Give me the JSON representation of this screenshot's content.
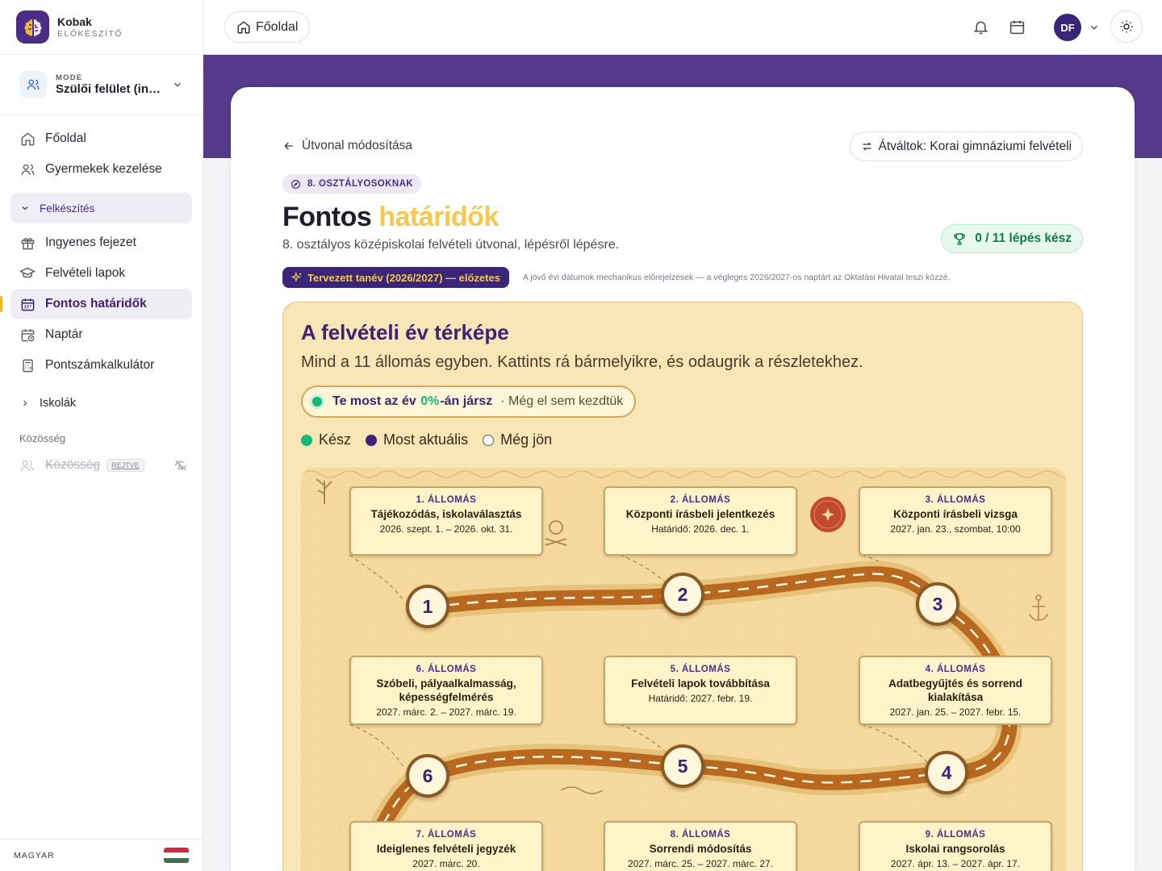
{
  "brand": {
    "name": "Kobak",
    "sub": "ELŐKÉSZÍTŐ"
  },
  "mode": {
    "label": "MODE",
    "value": "Szülői felület (ing..."
  },
  "nav": {
    "home": "Főoldal",
    "children": "Gyermekek kezelése",
    "section": "Felkészítés",
    "free_chapter": "Ingyenes fejezet",
    "sheets": "Felvételi lapok",
    "deadlines": "Fontos határidők",
    "calendar": "Naptár",
    "calculator": "Pontszámkalkulátor",
    "schools": "Iskolák",
    "community_group": "Közösség",
    "community": "Közösség",
    "hidden_badge": "REJTVE"
  },
  "footer": {
    "language": "MAGYAR"
  },
  "topbar": {
    "home": "Főoldal",
    "avatar": "DF"
  },
  "page": {
    "back": "Útvonal módosítása",
    "switch": "Átváltok: Korai gimnáziumi felvételi",
    "grade_tag": "8. OSZTÁLYOSOKNAK",
    "title_main": "Fontos",
    "title_highlight": "határidők",
    "subtitle": "8. osztályos középiskolai felvételi útvonal, lépésről lépésre.",
    "progress": "0 / 11 lépés kész",
    "planned": "Tervezett tanév (2026/2027) — előzetes",
    "planned_note": "A jövő évi dátumok mechanikus előrejelzések — a végleges 2026/2027-os naptárt az Oktatási Hivatal teszi közzé."
  },
  "map": {
    "title": "A felvételi év térképe",
    "subtitle": "Mind a 11 állomás egyben. Kattints rá bármelyikre, és odaugrik a részletekhez.",
    "status_a": "Te most az év",
    "status_pct": "0%",
    "status_b": "-án jársz",
    "status_c": "· Még el sem kezdtük",
    "progress_fraction": 0,
    "legend": {
      "done": "Kész",
      "current": "Most aktuális",
      "upcoming": "Még jön"
    },
    "colors": {
      "done": "#16b877",
      "current": "#3e2273",
      "road": "#b8691f"
    }
  },
  "stations": [
    {
      "num": "1. ÁLLOMÁS",
      "title": "Tájékozódás, iskolaválasztás",
      "date": "2026. szept. 1. – 2026. okt. 31.",
      "stop": "1"
    },
    {
      "num": "2. ÁLLOMÁS",
      "title": "Központi írásbeli jelentkezés",
      "date": "Határidő: 2026. dec. 1.",
      "stop": "2"
    },
    {
      "num": "3. ÁLLOMÁS",
      "title": "Központi írásbeli vizsga",
      "date": "2027. jan. 23., szombat, 10:00",
      "stop": "3"
    },
    {
      "num": "4. ÁLLOMÁS",
      "title": "Adatbegyűjtés és sorrend kialakítása",
      "date": "2027. jan. 25. – 2027. febr. 15.",
      "stop": "4"
    },
    {
      "num": "5. ÁLLOMÁS",
      "title": "Felvételi lapok továbbítása",
      "date": "Határidő: 2027. febr. 19.",
      "stop": "5"
    },
    {
      "num": "6. ÁLLOMÁS",
      "title": "Szóbeli, pályaalkalmasság, képességfelmérés",
      "date": "2027. márc. 2. – 2027. márc. 19.",
      "stop": "6"
    },
    {
      "num": "7. ÁLLOMÁS",
      "title": "Ideiglenes felvételi jegyzék",
      "date": "2027. márc. 20.",
      "stop": ""
    },
    {
      "num": "8. ÁLLOMÁS",
      "title": "Sorrendi módosítás",
      "date": "2027. márc. 25. – 2027. márc. 27.",
      "stop": ""
    },
    {
      "num": "9. ÁLLOMÁS",
      "title": "Iskolai rangsorolás",
      "date": "2027. ápr. 13. – 2027. ápr. 17.",
      "stop": ""
    }
  ]
}
